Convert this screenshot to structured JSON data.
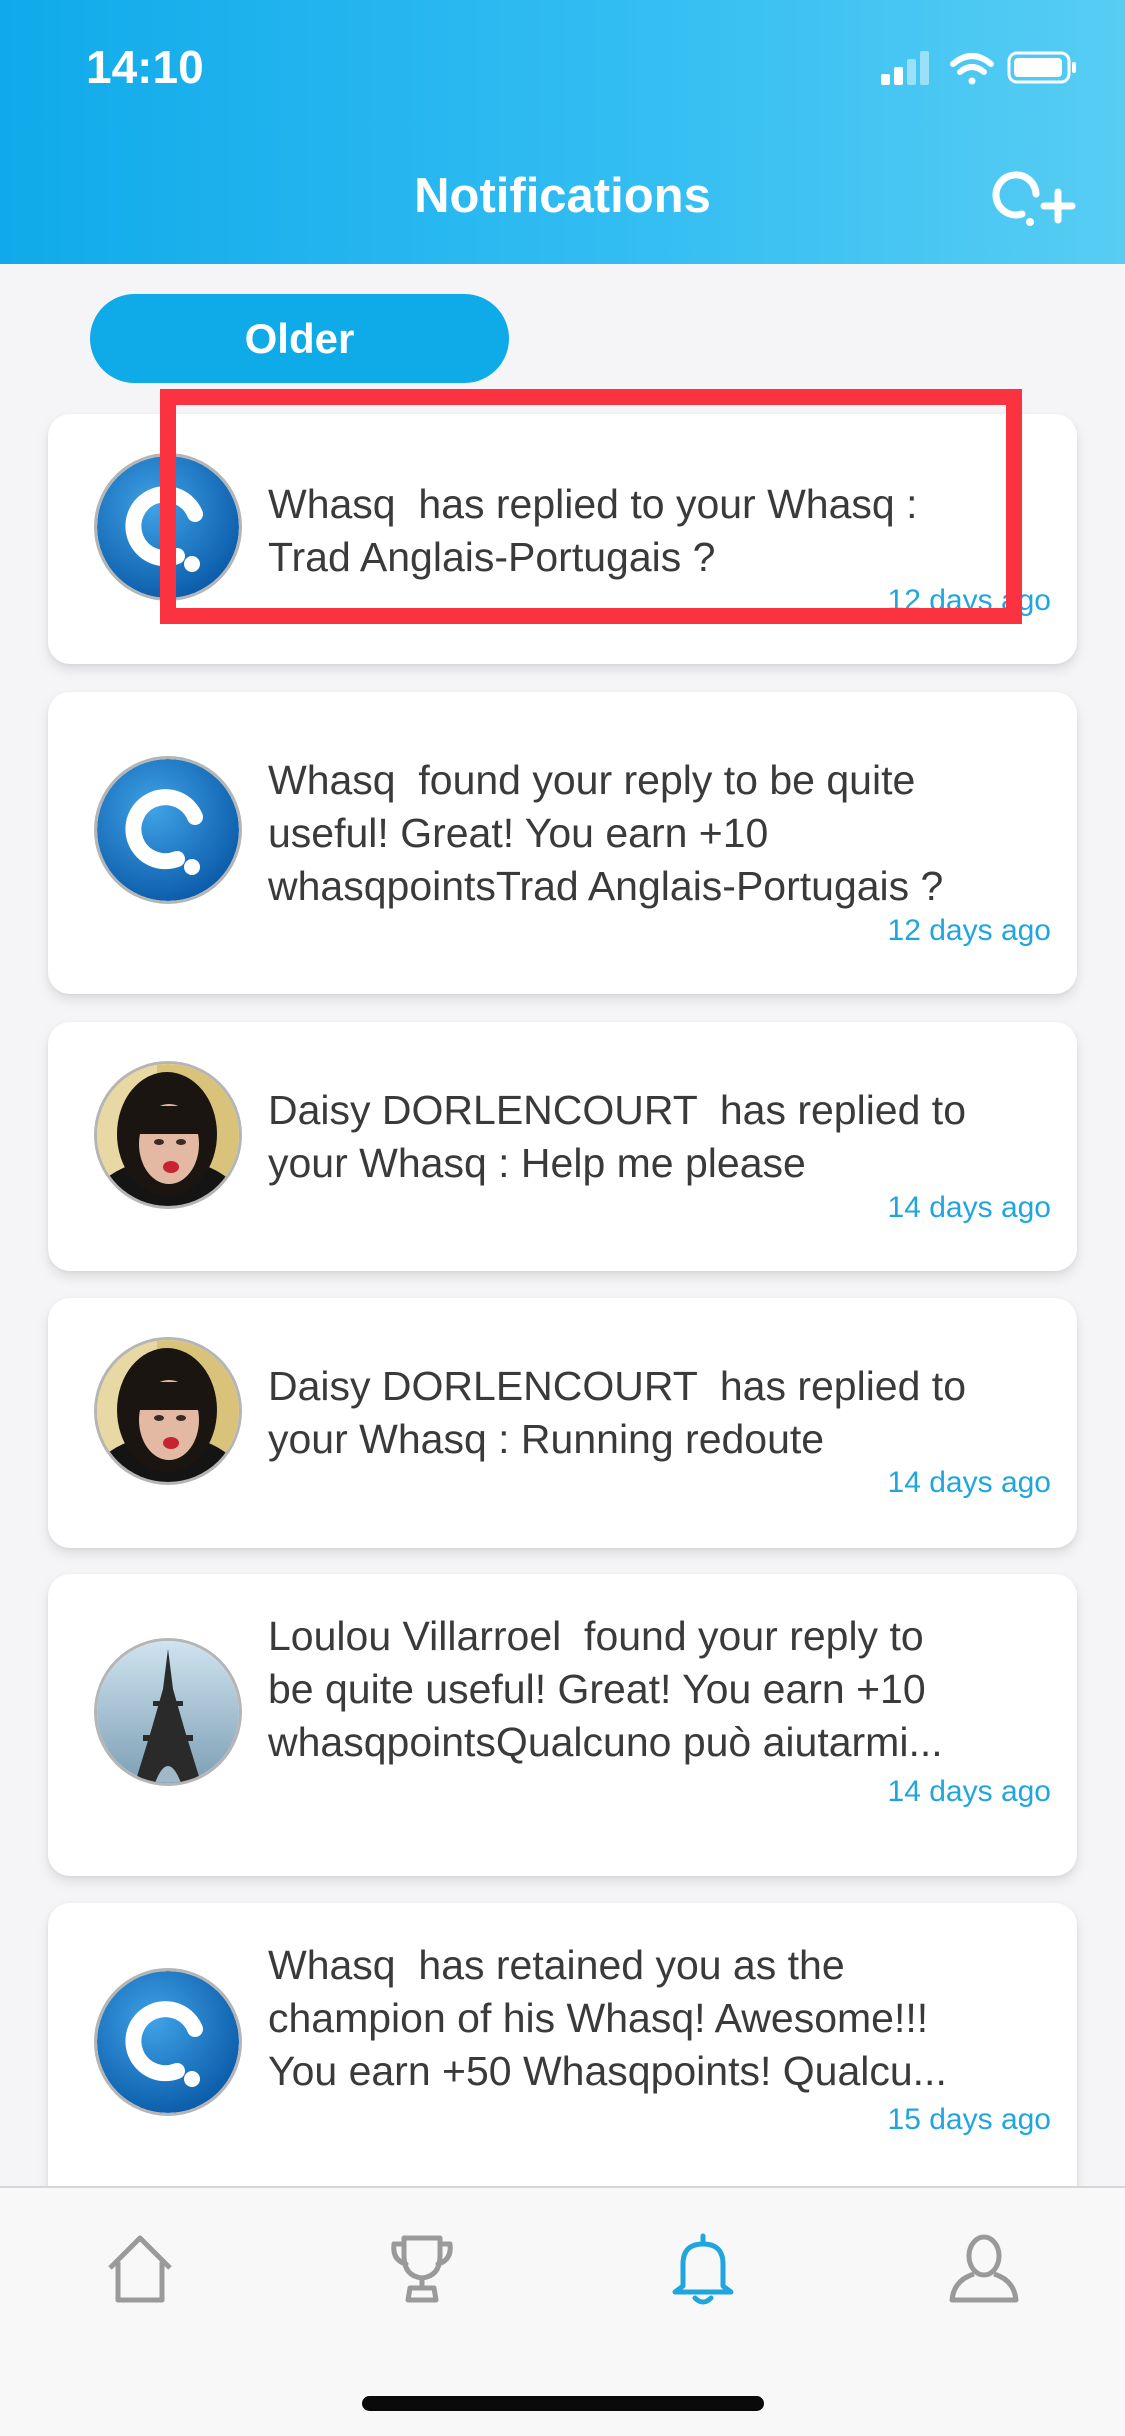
{
  "status_bar": {
    "time": "14:10"
  },
  "header": {
    "title": "Notifications",
    "new_whasq_icon": "search-plus-icon",
    "colors": {
      "gradient_start": "#10aaea",
      "gradient_end": "#57cdf3"
    }
  },
  "filter": {
    "label": "Older"
  },
  "notifications": [
    {
      "avatar": "whasq-logo",
      "message": "Whasq  has replied to your Whasq :\nTrad Anglais-Portugais ?",
      "time": "12 days ago",
      "highlighted": true
    },
    {
      "avatar": "whasq-logo",
      "message": "Whasq  found your reply to be quite\nuseful! Great! You earn +10\nwhasqpointsTrad Anglais-Portugais ?",
      "time": "12 days ago"
    },
    {
      "avatar": "user-photo-daisy",
      "message": "Daisy DORLENCOURT  has replied to\nyour Whasq : Help me please",
      "time": "14 days ago"
    },
    {
      "avatar": "user-photo-daisy",
      "message": "Daisy DORLENCOURT  has replied to\nyour Whasq : Running redoute",
      "time": "14 days ago"
    },
    {
      "avatar": "user-photo-eiffel",
      "message": "Loulou Villarroel  found your reply to\nbe quite useful! Great! You earn +10\nwhasqpointsQualcuno può aiutarmi...",
      "time": "14 days ago"
    },
    {
      "avatar": "whasq-logo",
      "message": "Whasq  has retained you as the\nchampion of his Whasq! Awesome!!!\nYou earn +50 Whasqpoints! Qualcu...",
      "time": "15 days ago"
    }
  ],
  "tab_bar": {
    "tabs": [
      {
        "name": "home",
        "icon": "home-icon"
      },
      {
        "name": "trophy",
        "icon": "trophy-icon"
      },
      {
        "name": "notifications",
        "icon": "bell-icon",
        "active": true
      },
      {
        "name": "profile",
        "icon": "user-icon"
      }
    ],
    "active_color": "#1fa6df",
    "inactive_color": "#9a9a9a"
  }
}
